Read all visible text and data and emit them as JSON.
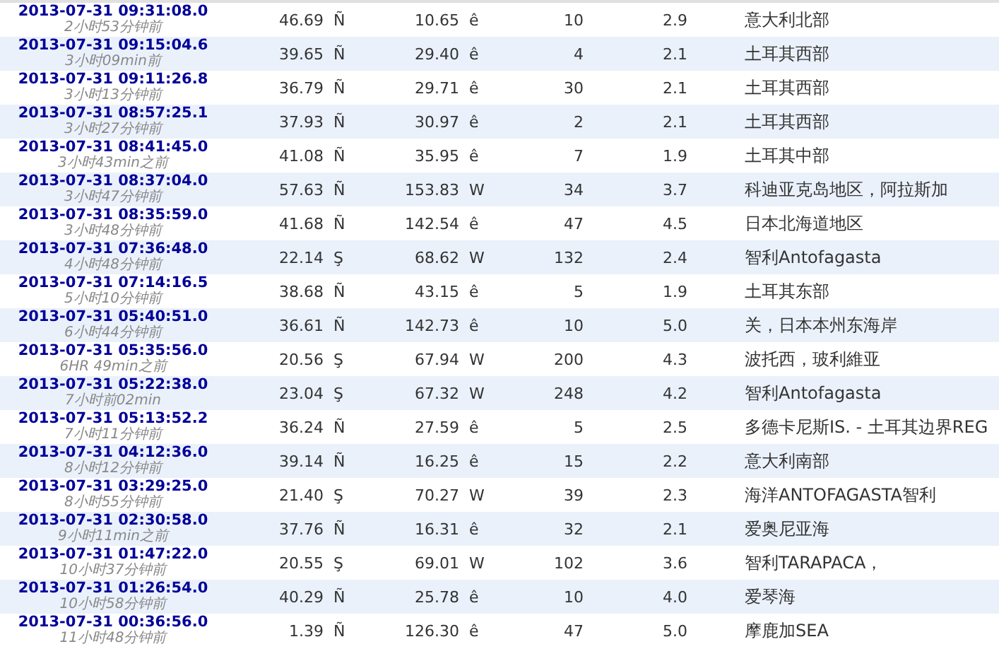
{
  "table": {
    "rows": [
      {
        "time": "2013-07-31 09:31:08.0",
        "ago": "2小时53分钟前",
        "lat": "46.69",
        "lat_dir": "Ñ",
        "lon": "10.65",
        "lon_dir": "ê",
        "depth": "10",
        "mag": "2.9",
        "region": "意大利北部"
      },
      {
        "time": "2013-07-31 09:15:04.6",
        "ago": "3小时09min前",
        "lat": "39.65",
        "lat_dir": "Ñ",
        "lon": "29.40",
        "lon_dir": "ê",
        "depth": "4",
        "mag": "2.1",
        "region": "土耳其西部"
      },
      {
        "time": "2013-07-31 09:11:26.8",
        "ago": "3小时13分钟前",
        "lat": "36.79",
        "lat_dir": "Ñ",
        "lon": "29.71",
        "lon_dir": "ê",
        "depth": "30",
        "mag": "2.1",
        "region": "土耳其西部"
      },
      {
        "time": "2013-07-31 08:57:25.1",
        "ago": "3小时27分钟前",
        "lat": "37.93",
        "lat_dir": "Ñ",
        "lon": "30.97",
        "lon_dir": "ê",
        "depth": "2",
        "mag": "2.1",
        "region": "土耳其西部"
      },
      {
        "time": "2013-07-31 08:41:45.0",
        "ago": "3小时43min之前",
        "lat": "41.08",
        "lat_dir": "Ñ",
        "lon": "35.95",
        "lon_dir": "ê",
        "depth": "7",
        "mag": "1.9",
        "region": "土耳其中部"
      },
      {
        "time": "2013-07-31 08:37:04.0",
        "ago": "3小时47分钟前",
        "lat": "57.63",
        "lat_dir": "Ñ",
        "lon": "153.83",
        "lon_dir": "W",
        "depth": "34",
        "mag": "3.7",
        "region": "科迪亚克岛地区，阿拉斯加"
      },
      {
        "time": "2013-07-31 08:35:59.0",
        "ago": "3小时48分钟前",
        "lat": "41.68",
        "lat_dir": "Ñ",
        "lon": "142.54",
        "lon_dir": "ê",
        "depth": "47",
        "mag": "4.5",
        "region": "日本北海道地区"
      },
      {
        "time": "2013-07-31 07:36:48.0",
        "ago": "4小时48分钟前",
        "lat": "22.14",
        "lat_dir": "Ş",
        "lon": "68.62",
        "lon_dir": "W",
        "depth": "132",
        "mag": "2.4",
        "region": "智利Antofagasta"
      },
      {
        "time": "2013-07-31 07:14:16.5",
        "ago": "5小时10分钟前",
        "lat": "38.68",
        "lat_dir": "Ñ",
        "lon": "43.15",
        "lon_dir": "ê",
        "depth": "5",
        "mag": "1.9",
        "region": "土耳其东部"
      },
      {
        "time": "2013-07-31 05:40:51.0",
        "ago": "6小时44分钟前",
        "lat": "36.61",
        "lat_dir": "Ñ",
        "lon": "142.73",
        "lon_dir": "ê",
        "depth": "10",
        "mag": "5.0",
        "region": "关，日本本州东海岸"
      },
      {
        "time": "2013-07-31 05:35:56.0",
        "ago": "6HR 49min之前",
        "lat": "20.56",
        "lat_dir": "Ş",
        "lon": "67.94",
        "lon_dir": "W",
        "depth": "200",
        "mag": "4.3",
        "region": "波托西，玻利維亚"
      },
      {
        "time": "2013-07-31 05:22:38.0",
        "ago": "7小时前02min",
        "lat": "23.04",
        "lat_dir": "Ş",
        "lon": "67.32",
        "lon_dir": "W",
        "depth": "248",
        "mag": "4.2",
        "region": "智利Antofagasta"
      },
      {
        "time": "2013-07-31 05:13:52.2",
        "ago": "7小时11分钟前",
        "lat": "36.24",
        "lat_dir": "Ñ",
        "lon": "27.59",
        "lon_dir": "ê",
        "depth": "5",
        "mag": "2.5",
        "region": "多德卡尼斯IS. - 土耳其边界REG"
      },
      {
        "time": "2013-07-31 04:12:36.0",
        "ago": "8小时12分钟前",
        "lat": "39.14",
        "lat_dir": "Ñ",
        "lon": "16.25",
        "lon_dir": "ê",
        "depth": "15",
        "mag": "2.2",
        "region": "意大利南部"
      },
      {
        "time": "2013-07-31 03:29:25.0",
        "ago": "8小时55分钟前",
        "lat": "21.40",
        "lat_dir": "Ş",
        "lon": "70.27",
        "lon_dir": "W",
        "depth": "39",
        "mag": "2.3",
        "region": "海洋ANTOFAGASTA智利"
      },
      {
        "time": "2013-07-31 02:30:58.0",
        "ago": "9小时11min之前",
        "lat": "37.76",
        "lat_dir": "Ñ",
        "lon": "16.31",
        "lon_dir": "ê",
        "depth": "32",
        "mag": "2.1",
        "region": "爱奥尼亚海"
      },
      {
        "time": "2013-07-31 01:47:22.0",
        "ago": "10小时37分钟前",
        "lat": "20.55",
        "lat_dir": "Ş",
        "lon": "69.01",
        "lon_dir": "W",
        "depth": "102",
        "mag": "3.6",
        "region": "智利TARAPACA，"
      },
      {
        "time": "2013-07-31 01:26:54.0",
        "ago": "10小时58分钟前",
        "lat": "40.29",
        "lat_dir": "Ñ",
        "lon": "25.78",
        "lon_dir": "ê",
        "depth": "10",
        "mag": "4.0",
        "region": "爱琴海"
      },
      {
        "time": "2013-07-31 00:36:56.0",
        "ago": "11小时48分钟前",
        "lat": "1.39",
        "lat_dir": "Ñ",
        "lon": "126.30",
        "lon_dir": "ê",
        "depth": "47",
        "mag": "5.0",
        "region": "摩鹿加SEA"
      }
    ]
  }
}
